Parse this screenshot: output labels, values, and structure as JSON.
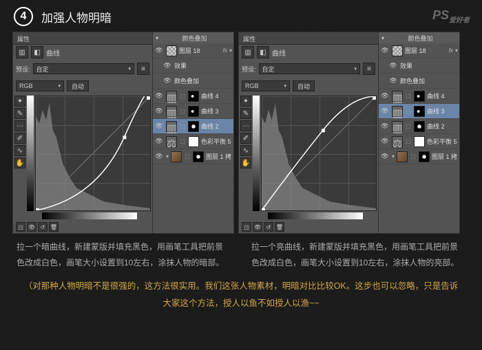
{
  "header": {
    "step": "4",
    "title": "加强人物明暗"
  },
  "watermark": "PS 爱好者",
  "props": {
    "tab": "属性",
    "panel_title": "曲线",
    "preset_label": "预设:",
    "preset_value": "自定",
    "channel": "RGB",
    "auto": "自动"
  },
  "layers": {
    "blend_mode": "颜色叠加",
    "fx_label": "效果",
    "items": [
      {
        "name": "图层 18",
        "fx": "fx"
      },
      {
        "name": "效果",
        "sub": true
      },
      {
        "name": "颜色叠加",
        "sub": true
      },
      {
        "name": "曲线 4"
      },
      {
        "name": "曲线 3"
      },
      {
        "name": "曲线 2",
        "selected_left": true
      },
      {
        "name": "色彩平衡 5"
      },
      {
        "name": "图层 1 拷..."
      }
    ]
  },
  "layers_right": {
    "blend_mode": "颜色叠加",
    "fx_label": "效果",
    "items": [
      {
        "name": "图层 18",
        "fx": "fx"
      },
      {
        "name": "效果",
        "sub": true
      },
      {
        "name": "颜色叠加",
        "sub": true
      },
      {
        "name": "曲线 4"
      },
      {
        "name": "曲线 3",
        "selected_right": true
      },
      {
        "name": "曲线 2"
      },
      {
        "name": "色彩平衡 5"
      },
      {
        "name": "图层 1 拷..."
      }
    ]
  },
  "instructions": {
    "left": "拉一个暗曲线，新建蒙版并填充黑色，用画笔工具把前景色改成白色，画笔大小设置到10左右，涂抹人物的暗部。",
    "right": "拉一个亮曲线，新建蒙版并填充黑色，用画笔工具把前景色改成白色，画笔大小设置到10左右，涂抹人物的亮部。"
  },
  "note": "（对那种人物明暗不是很强的，这方法很实用。我们这张人物素材，明暗对比比较OK。这步也可以忽略，只是告诉大家这个方法，授人以鱼不如授人以渔~~"
}
